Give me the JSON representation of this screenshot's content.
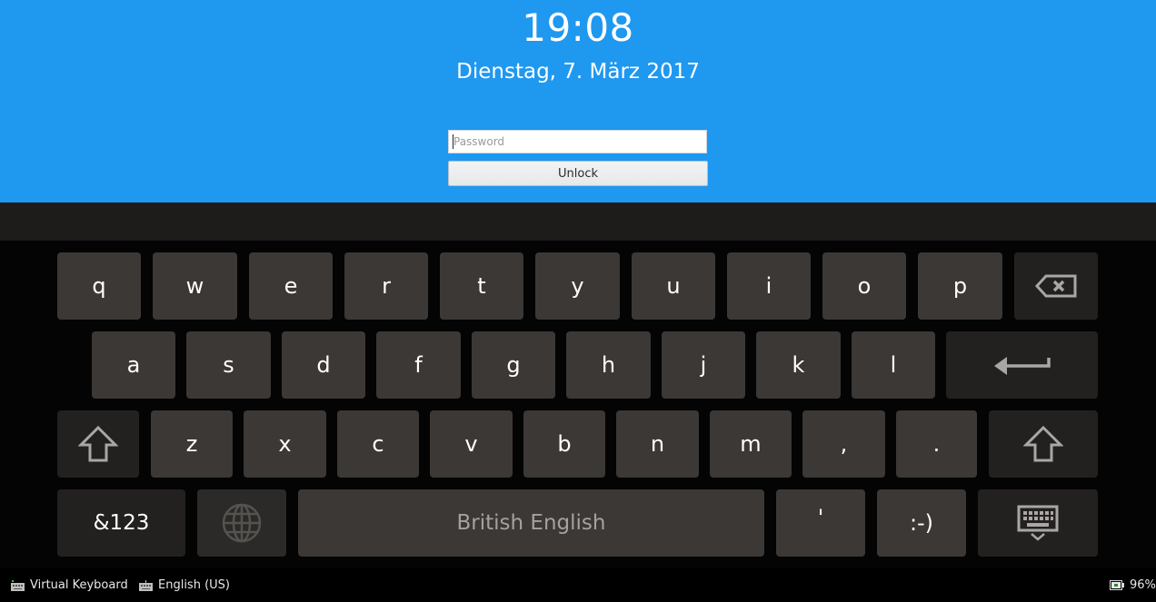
{
  "lockscreen": {
    "time": "19:08",
    "date": "Dienstag, 7. März 2017",
    "password_placeholder": "Password",
    "password_value": "",
    "unlock_label": "Unlock",
    "background_color": "#1f98f0"
  },
  "keyboard": {
    "rows": [
      [
        "q",
        "w",
        "e",
        "r",
        "t",
        "y",
        "u",
        "i",
        "o",
        "p"
      ],
      [
        "a",
        "s",
        "d",
        "f",
        "g",
        "h",
        "j",
        "k",
        "l"
      ],
      [
        "z",
        "x",
        "c",
        "v",
        "b",
        "n",
        "m",
        ",",
        "."
      ]
    ],
    "backspace_icon": "backspace-icon",
    "enter_icon": "enter-arrow-icon",
    "shift_icon": "shift-arrow-icon",
    "symbols_label": "&123",
    "language_icon": "globe-icon",
    "space_label": "British English",
    "apostrophe_label": "'",
    "smiley_label": ":-)",
    "hide_icon": "keyboard-hide-icon"
  },
  "statusbar": {
    "virtual_keyboard_label": "Virtual Keyboard",
    "layout_label": "English (US)",
    "battery_percent": "96%"
  }
}
